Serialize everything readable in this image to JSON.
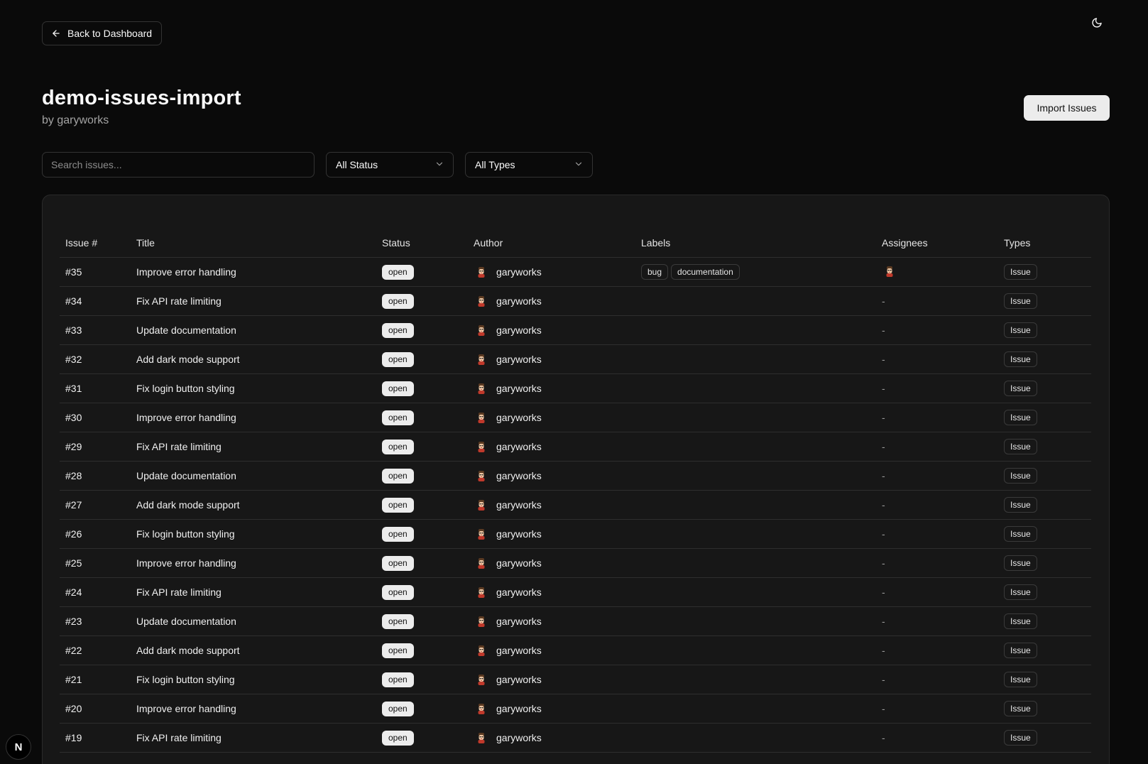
{
  "header": {
    "back_label": "Back to Dashboard",
    "theme_icon": "moon-icon"
  },
  "repo": {
    "name": "demo-issues-import",
    "owner_line": "by garyworks"
  },
  "actions": {
    "import_label": "Import Issues"
  },
  "filters": {
    "search_placeholder": "Search issues...",
    "status_value": "All Status",
    "types_value": "All Types"
  },
  "table": {
    "columns": [
      "Issue #",
      "Title",
      "Status",
      "Author",
      "Labels",
      "Assignees",
      "Types"
    ],
    "rows": [
      {
        "number": "#35",
        "title": "Improve error handling",
        "status": "open",
        "author": "garyworks",
        "labels": [
          "bug",
          "documentation"
        ],
        "assignee": "avatar",
        "type": "Issue"
      },
      {
        "number": "#34",
        "title": "Fix API rate limiting",
        "status": "open",
        "author": "garyworks",
        "labels": [],
        "assignee": "-",
        "type": "Issue"
      },
      {
        "number": "#33",
        "title": "Update documentation",
        "status": "open",
        "author": "garyworks",
        "labels": [],
        "assignee": "-",
        "type": "Issue"
      },
      {
        "number": "#32",
        "title": "Add dark mode support",
        "status": "open",
        "author": "garyworks",
        "labels": [],
        "assignee": "-",
        "type": "Issue"
      },
      {
        "number": "#31",
        "title": "Fix login button styling",
        "status": "open",
        "author": "garyworks",
        "labels": [],
        "assignee": "-",
        "type": "Issue"
      },
      {
        "number": "#30",
        "title": "Improve error handling",
        "status": "open",
        "author": "garyworks",
        "labels": [],
        "assignee": "-",
        "type": "Issue"
      },
      {
        "number": "#29",
        "title": "Fix API rate limiting",
        "status": "open",
        "author": "garyworks",
        "labels": [],
        "assignee": "-",
        "type": "Issue"
      },
      {
        "number": "#28",
        "title": "Update documentation",
        "status": "open",
        "author": "garyworks",
        "labels": [],
        "assignee": "-",
        "type": "Issue"
      },
      {
        "number": "#27",
        "title": "Add dark mode support",
        "status": "open",
        "author": "garyworks",
        "labels": [],
        "assignee": "-",
        "type": "Issue"
      },
      {
        "number": "#26",
        "title": "Fix login button styling",
        "status": "open",
        "author": "garyworks",
        "labels": [],
        "assignee": "-",
        "type": "Issue"
      },
      {
        "number": "#25",
        "title": "Improve error handling",
        "status": "open",
        "author": "garyworks",
        "labels": [],
        "assignee": "-",
        "type": "Issue"
      },
      {
        "number": "#24",
        "title": "Fix API rate limiting",
        "status": "open",
        "author": "garyworks",
        "labels": [],
        "assignee": "-",
        "type": "Issue"
      },
      {
        "number": "#23",
        "title": "Update documentation",
        "status": "open",
        "author": "garyworks",
        "labels": [],
        "assignee": "-",
        "type": "Issue"
      },
      {
        "number": "#22",
        "title": "Add dark mode support",
        "status": "open",
        "author": "garyworks",
        "labels": [],
        "assignee": "-",
        "type": "Issue"
      },
      {
        "number": "#21",
        "title": "Fix login button styling",
        "status": "open",
        "author": "garyworks",
        "labels": [],
        "assignee": "-",
        "type": "Issue"
      },
      {
        "number": "#20",
        "title": "Improve error handling",
        "status": "open",
        "author": "garyworks",
        "labels": [],
        "assignee": "-",
        "type": "Issue"
      },
      {
        "number": "#19",
        "title": "Fix API rate limiting",
        "status": "open",
        "author": "garyworks",
        "labels": [],
        "assignee": "-",
        "type": "Issue"
      }
    ]
  },
  "dev_badge": {
    "letter": "N"
  }
}
